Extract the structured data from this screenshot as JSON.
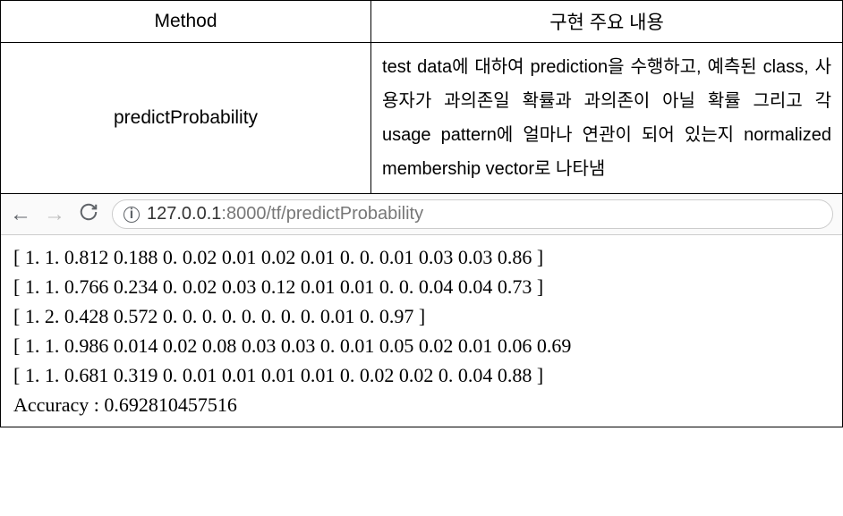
{
  "table": {
    "headers": {
      "method": "Method",
      "description": "구현 주요 내용"
    },
    "row": {
      "method": "predictProbability",
      "description": " test data에 대하여 prediction을 수행하고, 예측된 class, 사용자가 과의존일 확률과 과의존이 아닐 확률 그리고 각 usage pattern에 얼마나 연관이 되어 있는지 normalized membership vector로 나타냄"
    }
  },
  "browser": {
    "url_host": "127.0.0.1",
    "url_port_path": ":8000/tf/predictProbability"
  },
  "output": {
    "lines": [
      "[ 1. 1. 0.812 0.188 0. 0.02 0.01 0.02 0.01 0. 0. 0.01 0.03 0.03 0.86 ]",
      "[ 1. 1. 0.766 0.234 0. 0.02 0.03 0.12 0.01 0.01 0. 0. 0.04 0.04 0.73 ]",
      "[ 1. 2. 0.428 0.572 0. 0. 0. 0. 0. 0. 0. 0. 0.01 0. 0.97 ]",
      "[ 1. 1. 0.986 0.014 0.02 0.08 0.03 0.03 0. 0.01 0.05 0.02 0.01 0.06 0.69",
      "[ 1. 1. 0.681 0.319 0. 0.01 0.01 0.01 0.01 0. 0.02 0.02 0. 0.04 0.88 ]",
      "Accuracy : 0.692810457516"
    ]
  }
}
